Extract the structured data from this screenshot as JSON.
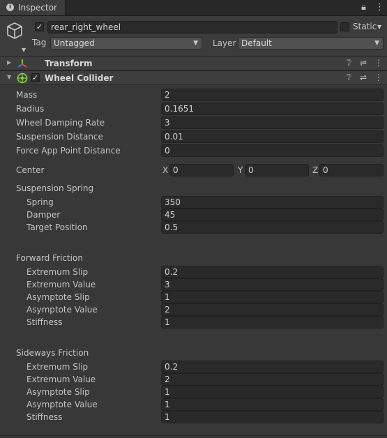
{
  "tab": {
    "title": "Inspector"
  },
  "header": {
    "active": true,
    "name": "rear_right_wheel",
    "static_label": "Static",
    "tag_label": "Tag",
    "tag_value": "Untagged",
    "layer_label": "Layer",
    "layer_value": "Default"
  },
  "transform": {
    "title": "Transform"
  },
  "wheel_collider": {
    "title": "Wheel Collider",
    "enabled": true,
    "props": [
      {
        "label": "Mass",
        "value": "2"
      },
      {
        "label": "Radius",
        "value": "0.1651"
      },
      {
        "label": "Wheel Damping Rate",
        "value": "3"
      },
      {
        "label": "Suspension Distance",
        "value": "0.01"
      },
      {
        "label": "Force App Point Distance",
        "value": "0"
      }
    ],
    "center": {
      "label": "Center",
      "x_label": "X",
      "x": "0",
      "y_label": "Y",
      "y": "0",
      "z_label": "Z",
      "z": "0"
    },
    "suspension_spring": {
      "label": "Suspension Spring",
      "props": [
        {
          "label": "Spring",
          "value": "350"
        },
        {
          "label": "Damper",
          "value": "45"
        },
        {
          "label": "Target Position",
          "value": "0.5"
        }
      ]
    },
    "forward_friction": {
      "label": "Forward Friction",
      "props": [
        {
          "label": "Extremum Slip",
          "value": "0.2"
        },
        {
          "label": "Extremum Value",
          "value": "3"
        },
        {
          "label": "Asymptote Slip",
          "value": "1"
        },
        {
          "label": "Asymptote Value",
          "value": "2"
        },
        {
          "label": "Stiffness",
          "value": "1"
        }
      ]
    },
    "sideways_friction": {
      "label": "Sideways Friction",
      "props": [
        {
          "label": "Extremum Slip",
          "value": "0.2"
        },
        {
          "label": "Extremum Value",
          "value": "2"
        },
        {
          "label": "Asymptote Slip",
          "value": "1"
        },
        {
          "label": "Asymptote Value",
          "value": "1"
        },
        {
          "label": "Stiffness",
          "value": "1"
        }
      ]
    }
  }
}
